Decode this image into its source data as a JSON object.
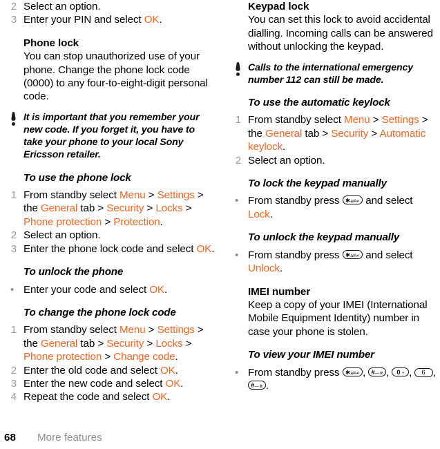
{
  "page": {
    "number": "68",
    "section": "More features"
  },
  "left_column": {
    "steps_top": [
      {
        "num": "2",
        "text": "Select an option."
      },
      {
        "num": "3",
        "pre": "Enter your PIN and select ",
        "link": "OK",
        "post": "."
      }
    ],
    "phone_lock": {
      "heading": "Phone lock",
      "body": "You can stop unauthorized use of your phone. Change the phone lock code (0000) to any four-to-eight-digit personal code."
    },
    "note": {
      "icon": "exclamation-icon",
      "text": "It is important that you remember your new code. If you forget it, you have to take your phone to your local Sony Ericsson retailer."
    },
    "use_phone_lock": {
      "heading": "To use the phone lock",
      "steps": [
        {
          "num": "1",
          "parts": [
            {
              "t": "From standby select ",
              "k": "plain"
            },
            {
              "t": "Menu",
              "k": "link"
            },
            {
              "t": " > ",
              "k": "plain"
            },
            {
              "t": "Settings",
              "k": "link"
            },
            {
              "t": " > the ",
              "k": "plain"
            },
            {
              "t": "General",
              "k": "link"
            },
            {
              "t": " tab > ",
              "k": "plain"
            },
            {
              "t": "Security",
              "k": "link"
            },
            {
              "t": " > ",
              "k": "plain"
            },
            {
              "t": "Locks",
              "k": "link"
            },
            {
              "t": " > ",
              "k": "plain"
            },
            {
              "t": "Phone protection",
              "k": "link"
            },
            {
              "t": " > ",
              "k": "plain"
            },
            {
              "t": "Protection",
              "k": "link"
            },
            {
              "t": ".",
              "k": "plain"
            }
          ]
        },
        {
          "num": "2",
          "text": "Select an option."
        },
        {
          "num": "3",
          "parts": [
            {
              "t": "Enter the phone lock code and select ",
              "k": "plain"
            },
            {
              "t": "OK",
              "k": "link"
            },
            {
              "t": ".",
              "k": "plain"
            }
          ]
        }
      ]
    },
    "unlock_phone": {
      "heading": "To unlock the phone",
      "bullet": {
        "parts": [
          {
            "t": "Enter your code and select ",
            "k": "plain"
          },
          {
            "t": "OK",
            "k": "link"
          },
          {
            "t": ".",
            "k": "plain"
          }
        ]
      }
    },
    "change_code": {
      "heading": "To change the phone lock code",
      "steps": [
        {
          "num": "1",
          "parts": [
            {
              "t": "From standby select ",
              "k": "plain"
            },
            {
              "t": "Menu",
              "k": "link"
            },
            {
              "t": " > ",
              "k": "plain"
            },
            {
              "t": "Settings",
              "k": "link"
            },
            {
              "t": " > the ",
              "k": "plain"
            },
            {
              "t": "General",
              "k": "link"
            },
            {
              "t": " tab > ",
              "k": "plain"
            },
            {
              "t": "Security",
              "k": "link"
            },
            {
              "t": " > ",
              "k": "plain"
            },
            {
              "t": "Locks",
              "k": "link"
            },
            {
              "t": " > ",
              "k": "plain"
            },
            {
              "t": "Phone protection",
              "k": "link"
            },
            {
              "t": " > ",
              "k": "plain"
            },
            {
              "t": "Change code",
              "k": "link"
            },
            {
              "t": ".",
              "k": "plain"
            }
          ]
        },
        {
          "num": "2",
          "parts": [
            {
              "t": "Enter the old code and select ",
              "k": "plain"
            },
            {
              "t": "OK",
              "k": "link"
            },
            {
              "t": ".",
              "k": "plain"
            }
          ]
        },
        {
          "num": "3",
          "parts": [
            {
              "t": "Enter the new code and select ",
              "k": "plain"
            },
            {
              "t": "OK",
              "k": "link"
            },
            {
              "t": ".",
              "k": "plain"
            }
          ]
        },
        {
          "num": "4",
          "parts": [
            {
              "t": "Repeat the code and select ",
              "k": "plain"
            },
            {
              "t": "OK",
              "k": "link"
            },
            {
              "t": ".",
              "k": "plain"
            }
          ]
        }
      ]
    }
  },
  "right_column": {
    "keypad_lock": {
      "heading": "Keypad lock",
      "body": "You can set this lock to avoid accidental dialling. Incoming calls can be answered without unlocking the keypad."
    },
    "note": {
      "icon": "exclamation-icon",
      "text": "Calls to the international emergency number 112 can still be made."
    },
    "automatic_keylock": {
      "heading": "To use the automatic keylock",
      "steps": [
        {
          "num": "1",
          "parts": [
            {
              "t": "From standby select ",
              "k": "plain"
            },
            {
              "t": "Menu",
              "k": "link"
            },
            {
              "t": " > ",
              "k": "plain"
            },
            {
              "t": "Settings",
              "k": "link"
            },
            {
              "t": " > the ",
              "k": "plain"
            },
            {
              "t": "General",
              "k": "link"
            },
            {
              "t": " tab > ",
              "k": "plain"
            },
            {
              "t": "Security",
              "k": "link"
            },
            {
              "t": " > ",
              "k": "plain"
            },
            {
              "t": "Automatic keylock",
              "k": "link"
            },
            {
              "t": ".",
              "k": "plain"
            }
          ]
        },
        {
          "num": "2",
          "text": "Select an option."
        }
      ]
    },
    "lock_manually": {
      "heading": "To lock the keypad manually",
      "bullet_pre": "From standby press ",
      "bullet_mid": " and select ",
      "bullet_link": "Lock",
      "bullet_post": "."
    },
    "unlock_manually": {
      "heading": "To unlock the keypad manually",
      "bullet_pre": "From standby press ",
      "bullet_mid": " and select ",
      "bullet_link": "Unlock",
      "bullet_post": "."
    },
    "imei": {
      "heading": "IMEI number",
      "body": "Keep a copy of your IMEI (International Mobile Equipment Identity) number in case your phone is stolen."
    },
    "view_imei": {
      "heading": "To view your IMEI number",
      "bullet_pre": "From standby press ",
      "sep1": ", ",
      "sep2": ", ",
      "sep3": ", ",
      "sep4": ", ",
      "end": "."
    }
  },
  "keys": {
    "star": {
      "sym": "∗",
      "label": "a/A",
      "arrow": "↵"
    },
    "hash": {
      "sym": "#",
      "dash": "—",
      "label": "ぁ"
    },
    "zero": {
      "sym": "0",
      "plus": "+"
    },
    "six": {
      "sym": "6"
    }
  },
  "colors": {
    "accent": "#f26522",
    "step_number": "#9a9a9a",
    "footer_section": "#8d8d8d",
    "text": "#000000"
  }
}
